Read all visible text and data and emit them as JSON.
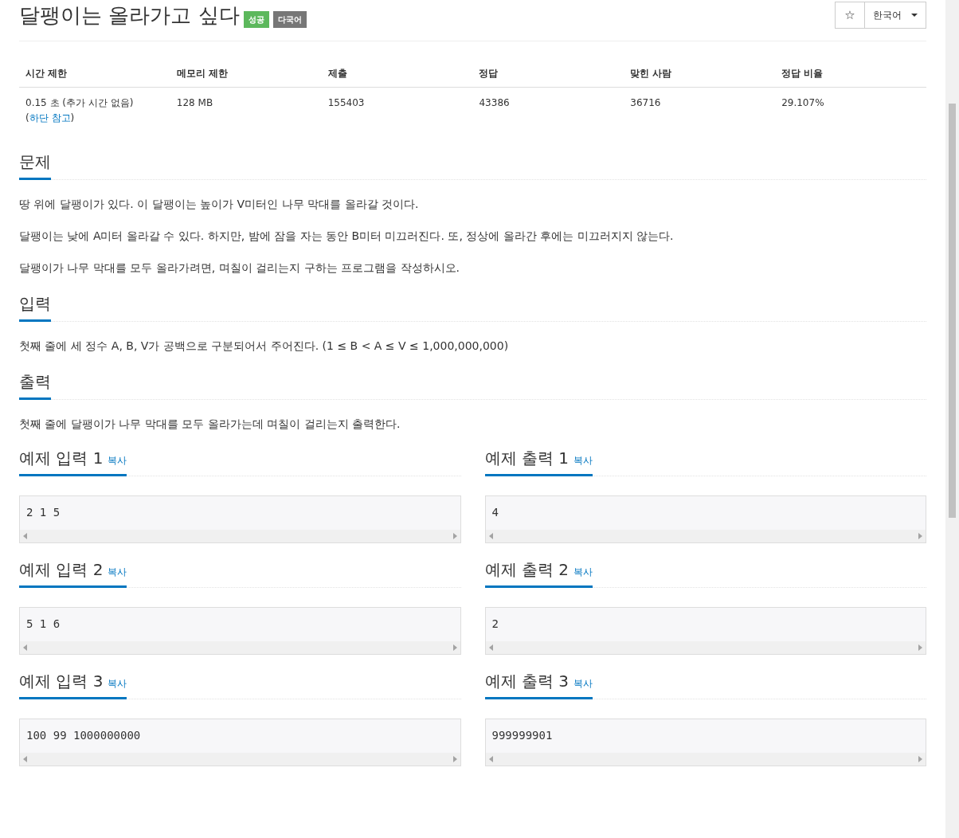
{
  "title": "달팽이는 올라가고 싶다",
  "badges": [
    {
      "label": "성공",
      "color": "#5cb85c"
    },
    {
      "label": "다국어",
      "color": "#777777"
    }
  ],
  "star_button": {
    "icon": "☆"
  },
  "language_dropdown": {
    "label": "한국어"
  },
  "stats": {
    "columns": [
      "시간 제한",
      "메모리 제한",
      "제출",
      "정답",
      "맞힌 사람",
      "정답 비율"
    ],
    "row": [
      {
        "text": "0.15 초 (추가 시간 없음) (",
        "link": "하단 참고",
        "after": ")"
      },
      {
        "text": "128 MB"
      },
      {
        "text": "155403"
      },
      {
        "text": "43386"
      },
      {
        "text": "36716"
      },
      {
        "text": "29.107%"
      }
    ]
  },
  "sections": [
    {
      "heading": "문제",
      "paragraphs": [
        "땅 위에 달팽이가 있다. 이 달팽이는 높이가 V미터인 나무 막대를 올라갈 것이다.",
        "달팽이는 낮에 A미터 올라갈 수 있다. 하지만, 밤에 잠을 자는 동안 B미터 미끄러진다. 또, 정상에 올라간 후에는 미끄러지지 않는다.",
        "달팽이가 나무 막대를 모두 올라가려면, 며칠이 걸리는지 구하는 프로그램을 작성하시오."
      ]
    },
    {
      "heading": "입력",
      "paragraphs": [
        "첫째 줄에 세 정수 A, B, V가 공백으로 구분되어서 주어진다. (1 ≤ B < A ≤ V ≤ 1,000,000,000)"
      ]
    },
    {
      "heading": "출력",
      "paragraphs": [
        "첫째 줄에 달팽이가 나무 막대를 모두 올라가는데 며칠이 걸리는지 출력한다."
      ]
    }
  ],
  "samples": [
    {
      "heading": "예제 입력 1",
      "copy": "복사",
      "content": "2 1 5"
    },
    {
      "heading": "예제 출력 1",
      "copy": "복사",
      "content": "4"
    },
    {
      "heading": "예제 입력 2",
      "copy": "복사",
      "content": "5 1 6"
    },
    {
      "heading": "예제 출력 2",
      "copy": "복사",
      "content": "2"
    },
    {
      "heading": "예제 입력 3",
      "copy": "복사",
      "content": "100 99 1000000000"
    },
    {
      "heading": "예제 출력 3",
      "copy": "복사",
      "content": "999999901"
    }
  ]
}
